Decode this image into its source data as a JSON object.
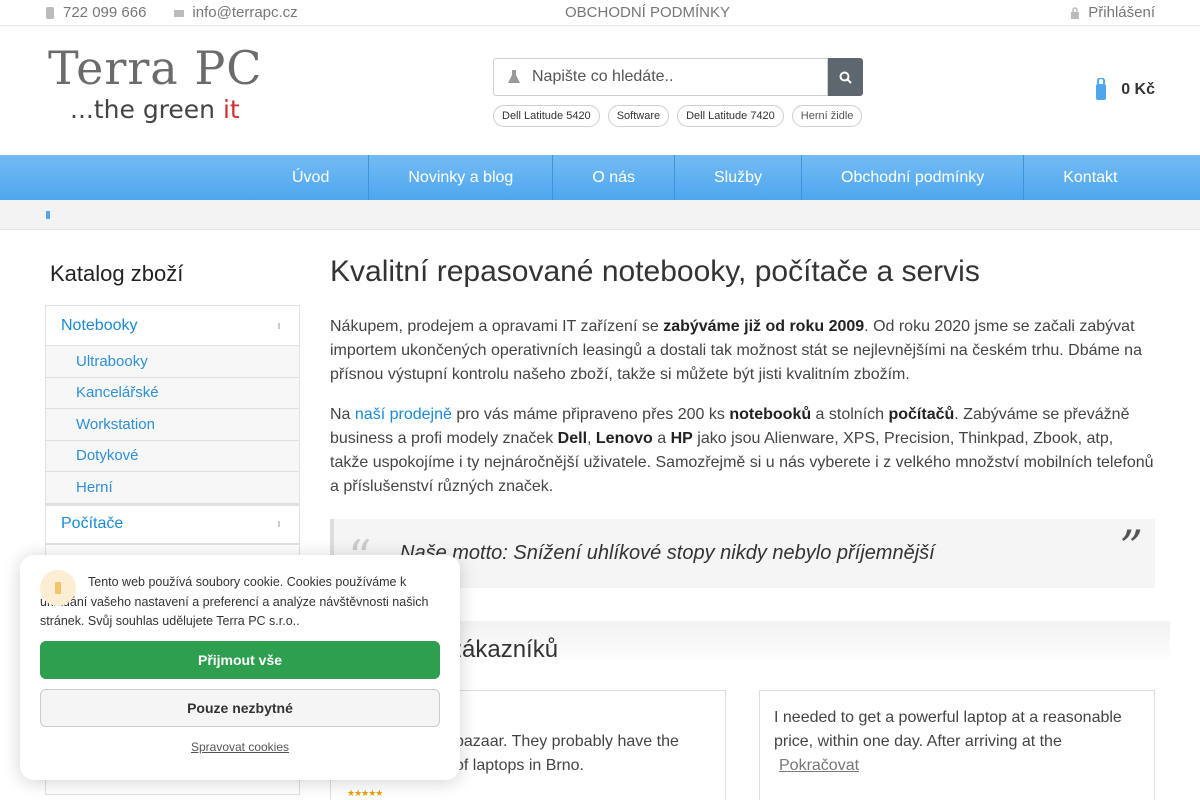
{
  "topbar": {
    "phone": "722 099 666",
    "email": "info@terrapc.cz",
    "terms": "OBCHODNÍ PODMÍNKY",
    "login": "Přihlášení"
  },
  "logo": {
    "main": "Terra PC",
    "sub_prefix": "...the green ",
    "sub_it": "it"
  },
  "search": {
    "placeholder": "Napište co hledáte.."
  },
  "tags": [
    "Dell Latitude 5420",
    "Software",
    "Dell Latitude 7420",
    "Herní židle"
  ],
  "cart": {
    "total": "0 Kč"
  },
  "nav": [
    "Úvod",
    "Novinky a blog",
    "O nás",
    "Služby",
    "Obchodní podmínky",
    "Kontakt"
  ],
  "sidebar": {
    "title": "Katalog zboží",
    "cat1": "Notebooky",
    "subs": [
      "Ultrabooky",
      "Kancelářské",
      "Workstation",
      "Dotykové",
      "Herní"
    ],
    "cat2": "Počítače"
  },
  "main": {
    "title": "Kvalitní repasované notebooky, počítače a servis",
    "p1_a": "Nákupem, prodejem a opravami IT zařízení se ",
    "p1_b": "zabýváme již od roku 2009",
    "p1_c": ". Od roku 2020 jsme se začali zabývat importem ukončených operativních leasingů a dostali tak možnost stát se nejlevnějšími na českém trhu. Dbáme na přísnou výstupní kontrolu našeho zboží, takže si můžete být jisti kvalitním zbožím.",
    "p2_a": "Na ",
    "p2_link": "naší prodejně",
    "p2_b": " pro vás máme připraveno přes 200 ks ",
    "p2_c": "notebooků",
    "p2_d": " a stolních ",
    "p2_e": "počítačů",
    "p2_f": ". Zabýváme se převážně business a profi modely značek ",
    "p2_g": "Dell",
    "p2_h": ", ",
    "p2_i": "Lenovo",
    "p2_j": " a ",
    "p2_k": "HP",
    "p2_l": " jako jsou Alienware, XPS, Precision, Thinkpad, Zbook, atp, takže uspokojíme i ty nejnáročnější uživatele. Samozřejmě si u nás vyberete i z velkého množství mobilních telefonů a příslušenství různých značek.",
    "motto": "Naše motto: Snížení uhlíkové stopy nikdy nebylo příjemnější",
    "quote_open": "“",
    "quote_close": "”"
  },
  "reviews": {
    "title": "zákazníků",
    "r1": "bazaar. They probably have the\nof laptops in Brno.",
    "r1_stars": "★★★★★",
    "r2": "I needed to get a powerful laptop at a reasonable price, within one day. After arriving at the",
    "r2_more": "Pokračovat"
  },
  "cookie": {
    "text": "Tento web používá soubory cookie. Cookies používáme k ukládání vašeho nastavení a preferencí a analýze návštěvnosti našich stránek. Svůj souhlas udělujete Terra PC s.r.o..",
    "accept": "Přijmout vše",
    "necessary": "Pouze nezbytné",
    "manage": "Spravovat cookies"
  },
  "colors": {
    "accent": "#4da7ee",
    "link": "#1a8ad6",
    "accept": "#2e9e4f"
  }
}
